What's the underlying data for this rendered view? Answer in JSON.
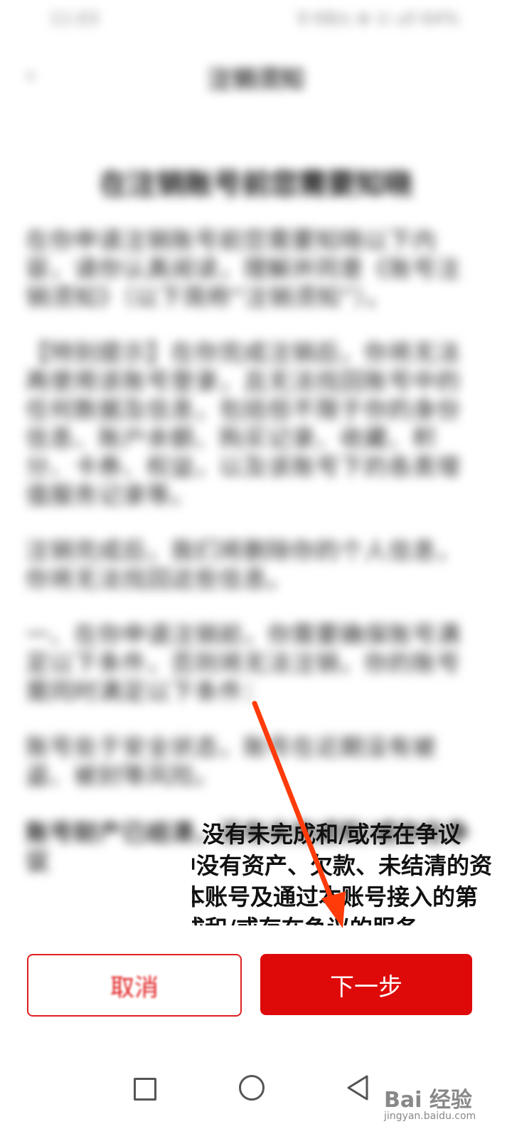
{
  "status": {
    "time": "11:03",
    "indicators": "9 KB/s ⊕ ⊙ ull 64%"
  },
  "header": {
    "back_glyph": "‹",
    "title": "注销须知"
  },
  "doc": {
    "title": "在注销账号前您需要知晓",
    "paragraphs": [
      "在你申请注销账号前您需要知晓以下内容，请你认真阅读，理解并同意《账号注销须知》（以下简称“注销须知”）。",
      "【特别提示】在你完成注销后，你将无法再使用该账号登录，且无法找回账号中的任何数据及信息，包括但不限于你的身份信息、账户余额、购买记录、收藏、积分、卡券、权益，以及该账号下的各类增值服务记录等。",
      "注销完成后，我们将删除你的个人信息，你将无法找回这些信息。",
      "一、在你申请注销前，你需要确保账号满足以下条件，否则将无法注销，你的账号需同时满足以下条件：",
      "账号处于安全状态，账号在近期没有被盗、被封等风险。",
      "账号财产已结清，没有未完成和/或存在争议"
    ],
    "sharp_lines": [
      "没有未完成和/或存在争议",
      "中没有资产、欠款、未结清的资",
      "本账号及通过本账号接入的第",
      "有未完成和/或存在争议的服务。"
    ]
  },
  "buttons": {
    "cancel": "取消",
    "next": "下一步"
  },
  "nav": {
    "square": "recent-apps",
    "circle": "home",
    "triangle": "back"
  },
  "watermark": {
    "main": "Bai 经验",
    "sub": "jingyan.baidu.com"
  },
  "colors": {
    "accent": "#de0a0a",
    "arrow": "#ff3b0a"
  }
}
